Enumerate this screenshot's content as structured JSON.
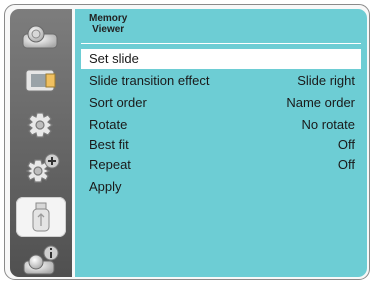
{
  "panel": {
    "title_line1": "Memory",
    "title_line2": "Viewer"
  },
  "menu": [
    {
      "label": "Set slide",
      "value": "",
      "selected": true
    },
    {
      "label": "Slide transition effect",
      "value": "Slide right"
    },
    {
      "label": "Sort order",
      "value": "Name order"
    },
    {
      "label": "Rotate",
      "value": "No rotate"
    },
    {
      "label": "Best fit",
      "value": "Off"
    },
    {
      "label": "Repeat",
      "value": "Off"
    },
    {
      "label": "Apply",
      "value": ""
    }
  ],
  "sidebar_tabs": [
    {
      "icon": "projector-display-icon",
      "active": false
    },
    {
      "icon": "image-adjust-icon",
      "active": false
    },
    {
      "icon": "settings-gear-icon",
      "active": false
    },
    {
      "icon": "expanded-settings-icon",
      "active": false
    },
    {
      "icon": "usb-memory-icon",
      "active": true
    },
    {
      "icon": "projector-info-icon",
      "active": false
    }
  ],
  "colors": {
    "accent": "#6dcdd4",
    "sidebar": "#5f5f5f",
    "selected_row": "#ffffff"
  }
}
